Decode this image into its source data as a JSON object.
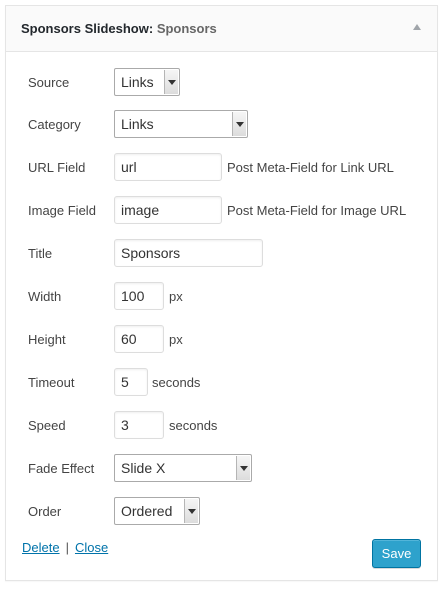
{
  "header": {
    "widget_name": "Sponsors Slideshow:",
    "instance_title": "Sponsors"
  },
  "fields": {
    "source": {
      "label": "Source",
      "value": "Links"
    },
    "category": {
      "label": "Category",
      "value": "Links"
    },
    "url_field": {
      "label": "URL Field",
      "value": "url",
      "note": "Post Meta-Field for Link URL"
    },
    "image_field": {
      "label": "Image Field",
      "value": "image",
      "note": "Post Meta-Field for Image URL"
    },
    "title": {
      "label": "Title",
      "value": "Sponsors"
    },
    "width": {
      "label": "Width",
      "value": "100",
      "unit": "px"
    },
    "height": {
      "label": "Height",
      "value": "60",
      "unit": "px"
    },
    "timeout": {
      "label": "Timeout",
      "value": "5",
      "unit": "seconds"
    },
    "speed": {
      "label": "Speed",
      "value": "3",
      "unit": "seconds"
    },
    "fade_effect": {
      "label": "Fade Effect",
      "value": "Slide X"
    },
    "order": {
      "label": "Order",
      "value": "Ordered"
    }
  },
  "footer": {
    "delete_label": "Delete",
    "separator": "|",
    "close_label": "Close",
    "save_label": "Save"
  },
  "colors": {
    "link": "#0073aa",
    "primary_button": "#2ea2cc",
    "primary_button_border": "#0074a2"
  }
}
